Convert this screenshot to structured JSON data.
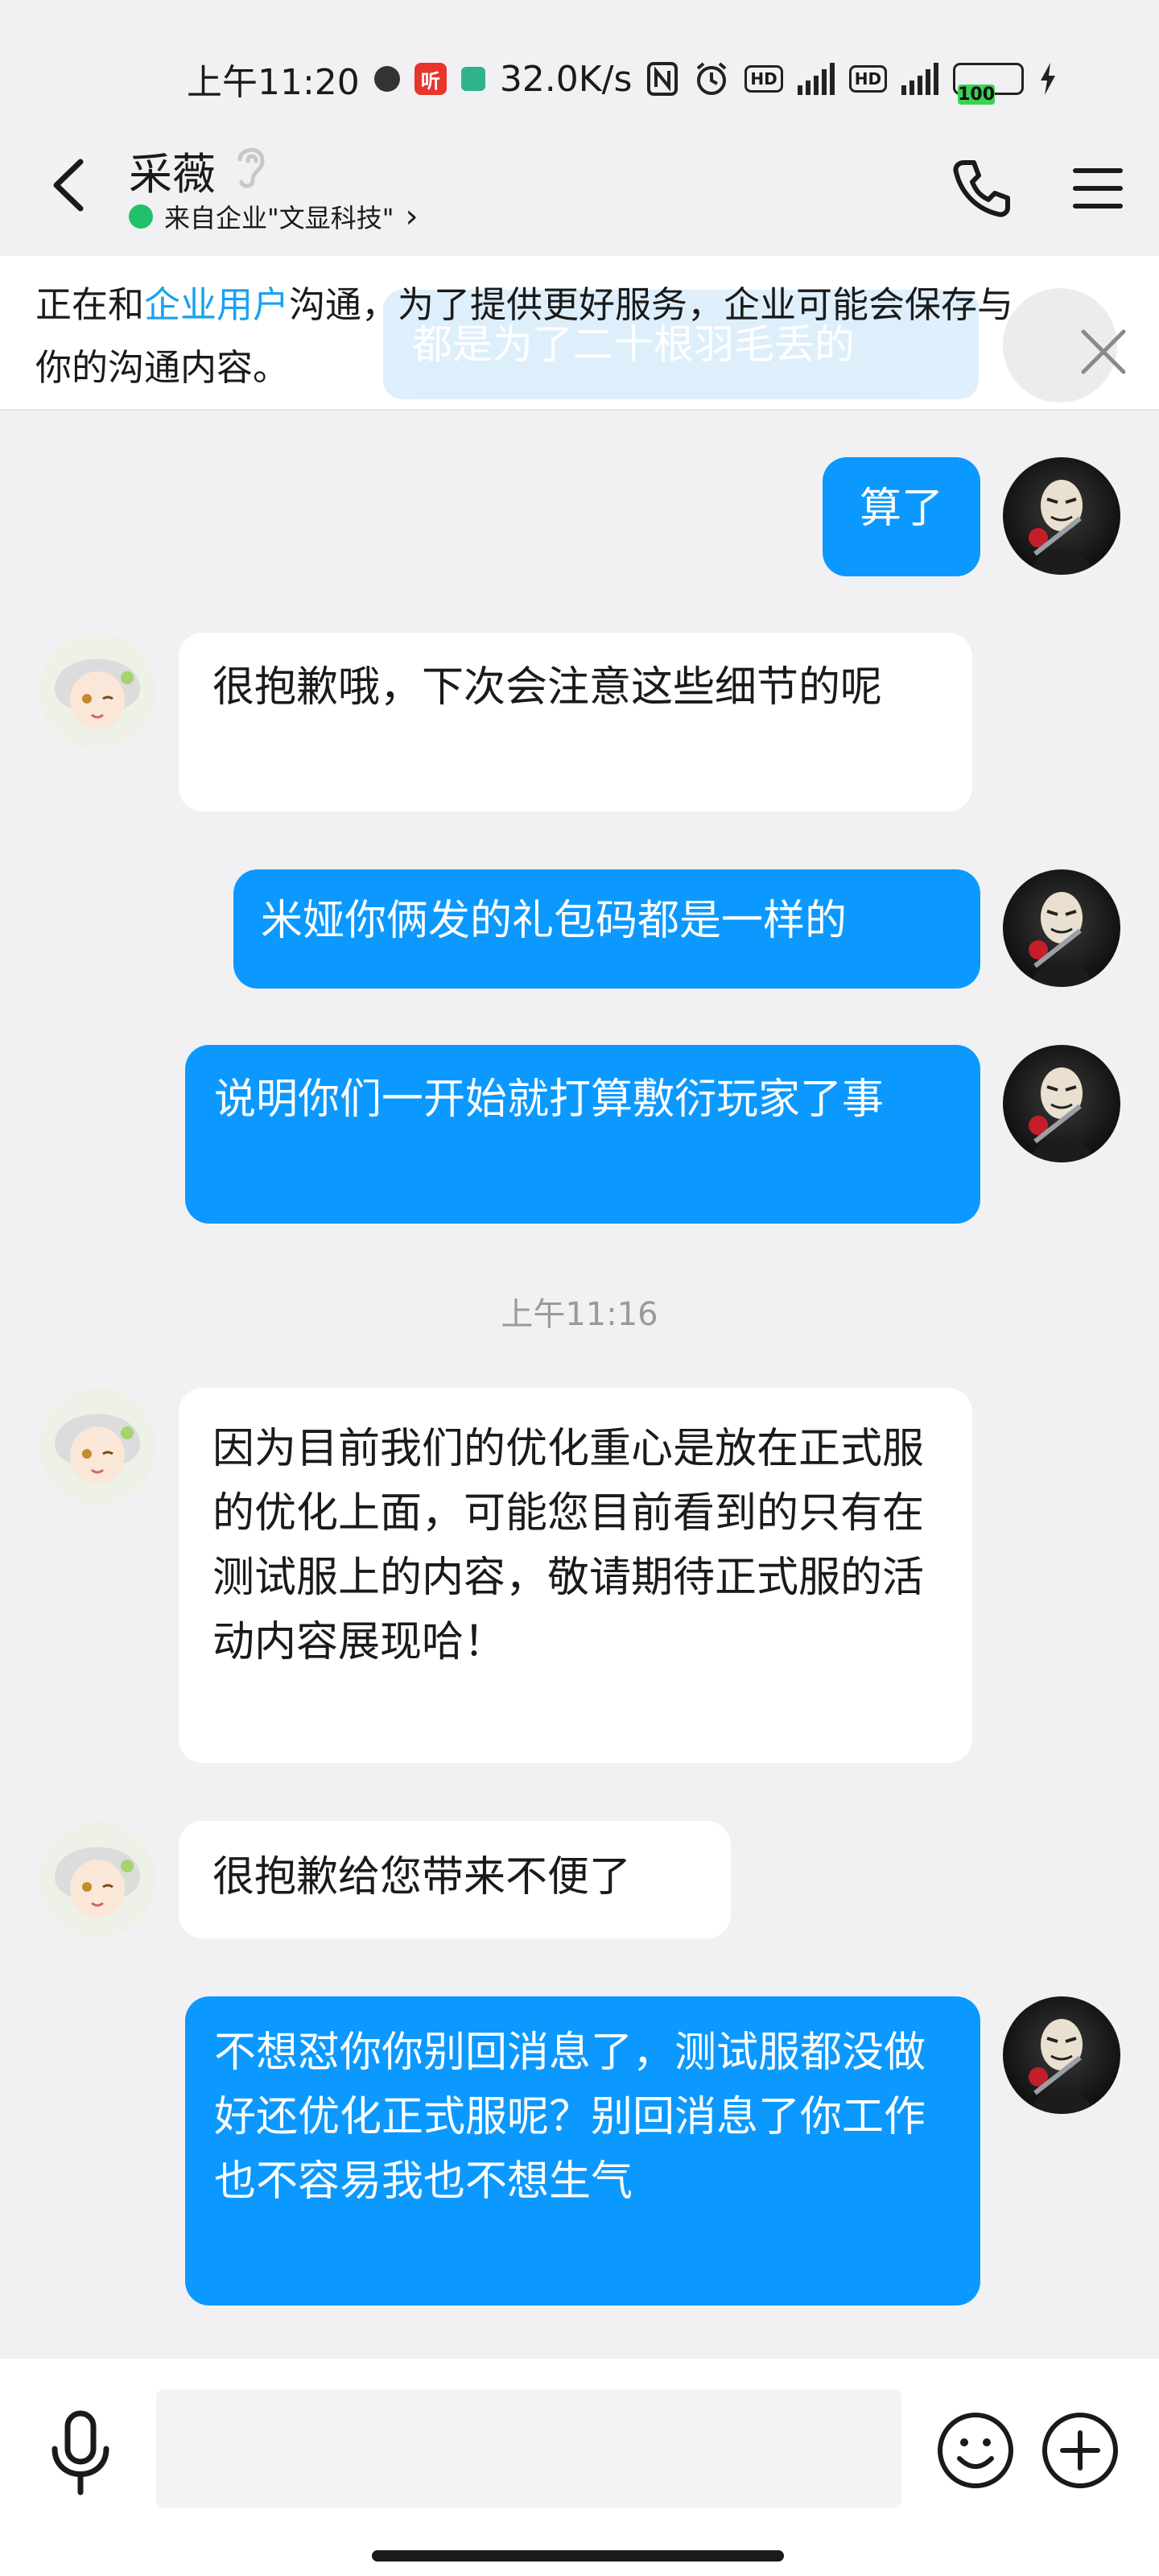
{
  "status_bar": {
    "time": "上午11:20",
    "network_speed": "32.0K/s",
    "red_app_badge": "听",
    "hd1": "HD",
    "hd2": "HD",
    "net1": "4G",
    "net2": "4G",
    "battery": "100",
    "icons": [
      "clock-app-icon",
      "listen-app-icon",
      "green-app-icon",
      "nfc-icon",
      "alarm-icon",
      "hd-icon",
      "signal-icon",
      "battery-icon",
      "charging-icon"
    ]
  },
  "header": {
    "contact_name": "采薇",
    "company_label": "来自企业\"文显科技\"",
    "chevron": "›"
  },
  "notice": {
    "prefix": "正在和",
    "highlight": "企业用户",
    "suffix": "沟通，为了提供更好服务，企业可能会保存与你的沟通内容。",
    "ghost_text": "都是为了二十根羽毛丢的",
    "highlight_color": "#1aa1f2"
  },
  "messages": [
    {
      "side": "out",
      "text": "算了"
    },
    {
      "side": "in",
      "text": "很抱歉哦，下次会注意这些细节的呢"
    },
    {
      "side": "out",
      "text": "米娅你俩发的礼包码都是一样的"
    },
    {
      "side": "out",
      "text": "说明你们一开始就打算敷衍玩家了事"
    },
    {
      "side": "in",
      "text": "因为目前我们的优化重心是放在正式服的优化上面，可能您目前看到的只有在测试服上的内容，敬请期待正式服的活动内容展现哈！"
    },
    {
      "side": "in",
      "text": "很抱歉给您带来不便了"
    },
    {
      "side": "out",
      "text": "不想怼你你别回消息了，测试服都没做好还优化正式服呢？别回消息了你工作也不容易我也不想生气"
    }
  ],
  "timestamp": "上午11:16",
  "input": {
    "placeholder": "",
    "value": ""
  },
  "colors": {
    "outgoing_bubble": "#0b99ff",
    "incoming_bubble": "#ffffff",
    "background": "#f1f1f3",
    "online": "#21c16b"
  }
}
